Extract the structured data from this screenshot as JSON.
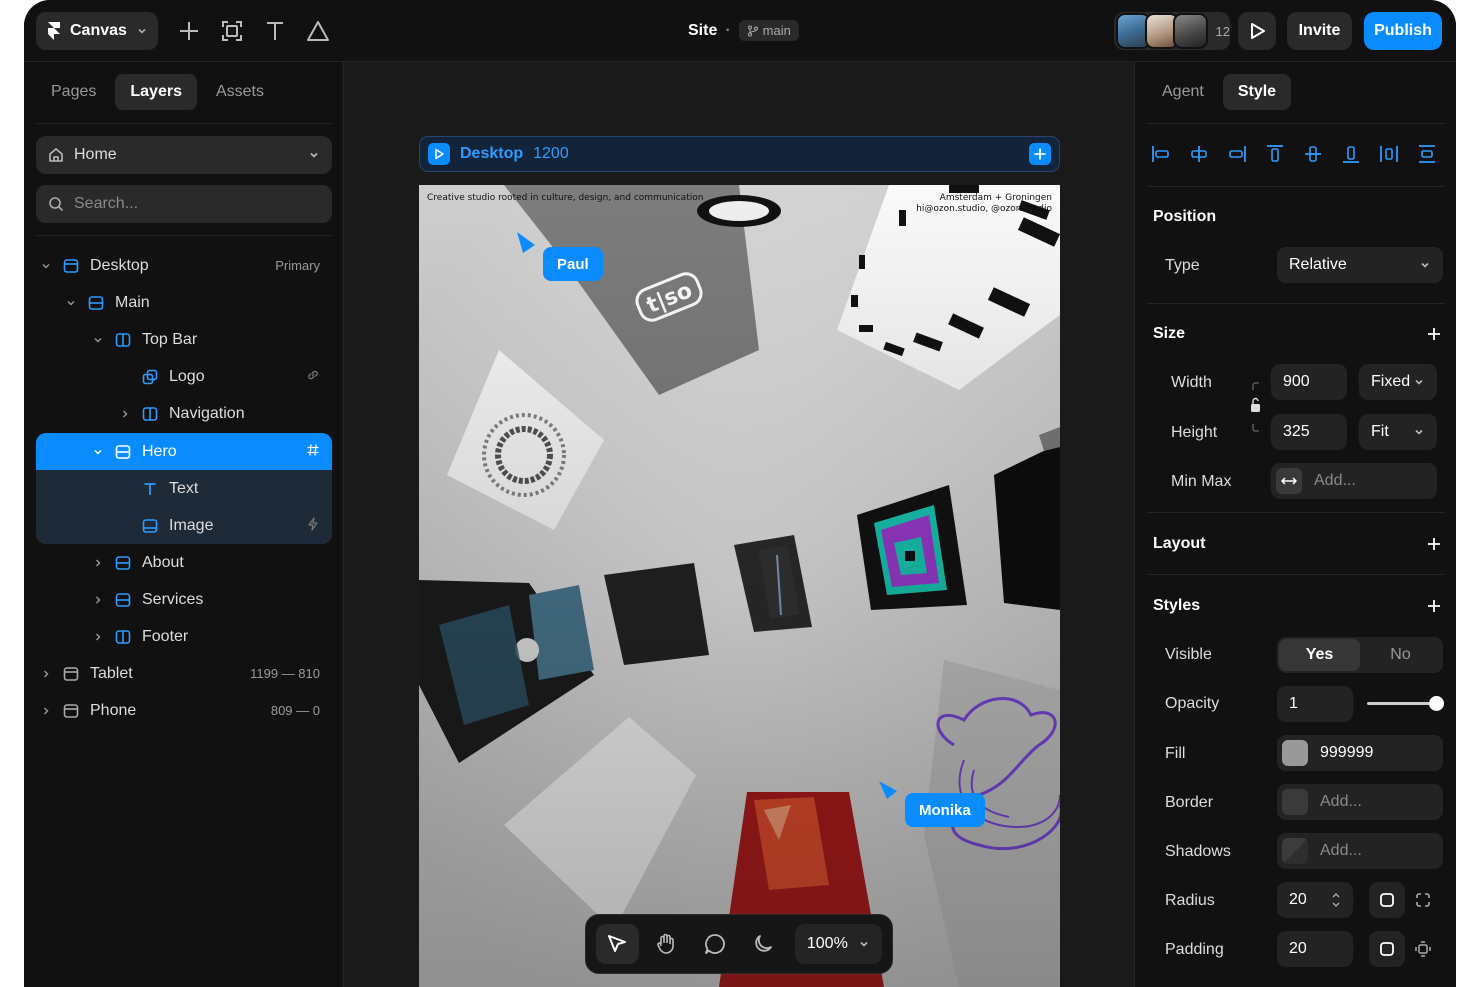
{
  "topbar": {
    "app_menu": "Canvas",
    "site_title": "Site",
    "separator": "·",
    "branch": "main",
    "collaborator_count": "12",
    "invite_label": "Invite",
    "publish_label": "Publish",
    "tools": [
      "add-icon",
      "frame-icon",
      "text-icon",
      "shape-icon"
    ]
  },
  "left_panel": {
    "tabs": [
      "Pages",
      "Layers",
      "Assets"
    ],
    "active_tab": "Layers",
    "page_select": "Home",
    "search_placeholder": "Search...",
    "layers": [
      {
        "label": "Desktop",
        "meta": "Primary",
        "icon": "breakpoint-icon"
      },
      {
        "label": "Main",
        "meta": "",
        "icon": "stack-icon"
      },
      {
        "label": "Top Bar",
        "meta": "",
        "icon": "columns-icon"
      },
      {
        "label": "Logo",
        "meta": "",
        "icon": "component-icon"
      },
      {
        "label": "Navigation",
        "meta": "",
        "icon": "columns-icon"
      },
      {
        "label": "Hero",
        "meta": "",
        "icon": "stack-icon"
      },
      {
        "label": "Text",
        "meta": "",
        "icon": "text-icon"
      },
      {
        "label": "Image",
        "meta": "",
        "icon": "image-icon"
      },
      {
        "label": "About",
        "meta": "",
        "icon": "stack-icon"
      },
      {
        "label": "Services",
        "meta": "",
        "icon": "stack-icon"
      },
      {
        "label": "Footer",
        "meta": "",
        "icon": "columns-icon"
      },
      {
        "label": "Tablet",
        "meta": "1199 — 810",
        "icon": "breakpoint-icon"
      },
      {
        "label": "Phone",
        "meta": "809 — 0",
        "icon": "breakpoint-icon"
      }
    ]
  },
  "canvas": {
    "frame_name": "Desktop",
    "frame_width": "1200",
    "site_header_left": "Creative studio rooted in culture, design, and communication",
    "site_header_right_1": "Amsterdam + Groningen",
    "site_header_right_2": "hi@ozon.studio, @ozon.studio",
    "logo_text": "t|so",
    "cursors": [
      "Paul",
      "Monika"
    ],
    "zoom": "100%"
  },
  "right_panel": {
    "tabs": [
      "Agent",
      "Style"
    ],
    "active_tab": "Style",
    "position": {
      "title": "Position",
      "type_label": "Type",
      "type_value": "Relative"
    },
    "size": {
      "title": "Size",
      "width_label": "Width",
      "width_value": "900",
      "width_mode": "Fixed",
      "height_label": "Height",
      "height_value": "325",
      "height_mode": "Fit",
      "minmax_label": "Min Max",
      "minmax_placeholder": "Add..."
    },
    "layout": {
      "title": "Layout"
    },
    "styles": {
      "title": "Styles",
      "visible_label": "Visible",
      "visible_yes": "Yes",
      "visible_no": "No",
      "opacity_label": "Opacity",
      "opacity_value": "1",
      "fill_label": "Fill",
      "fill_value": "999999",
      "border_label": "Border",
      "border_placeholder": "Add...",
      "shadows_label": "Shadows",
      "shadows_placeholder": "Add...",
      "radius_label": "Radius",
      "radius_value": "20",
      "padding_label": "Padding",
      "padding_value": "20"
    }
  },
  "colors": {
    "accent": "#0a8cff",
    "panel_bg": "#111111",
    "field_bg": "#232323",
    "fill_swatch": "#999999"
  }
}
